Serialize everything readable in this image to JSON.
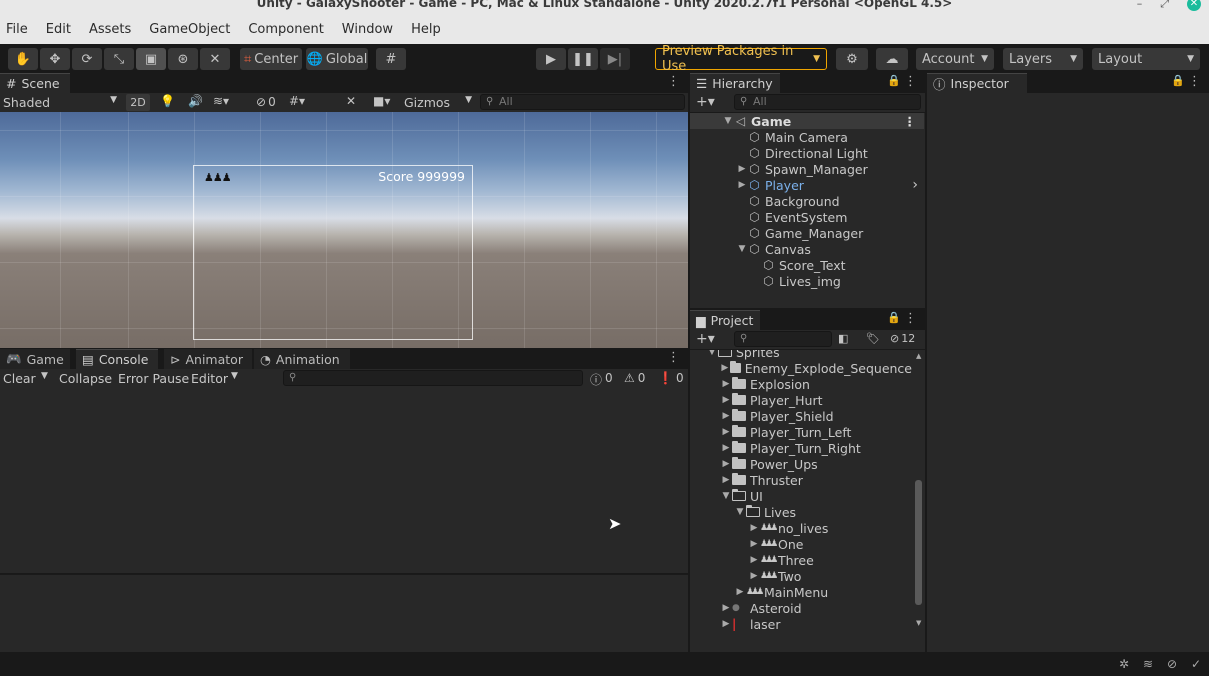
{
  "window": {
    "title": "Unity - GalaxyShooter - Game - PC, Mac & Linux Standalone - Unity 2020.2.7f1 Personal <OpenGL 4.5>",
    "minimize": "–",
    "restore": "⤢",
    "close": "✕"
  },
  "menu": [
    "File",
    "Edit",
    "Assets",
    "GameObject",
    "Component",
    "Window",
    "Help"
  ],
  "toolbar": {
    "center_label": "Center",
    "global_label": "Global",
    "preview_packages": "Preview Packages in Use",
    "account": "Account",
    "layers": "Layers",
    "layout": "Layout",
    "accent_color": "#f0a500"
  },
  "scene": {
    "tab": "Scene",
    "shading": "Shaded",
    "mode_2d": "2D",
    "hidden_count": "0",
    "gizmos": "Gizmos",
    "search_placeholder": "All",
    "score_text": "Score 999999",
    "lives_glyphs": "♟♟♟"
  },
  "bottom_tabs": [
    "Game",
    "Console",
    "Animator",
    "Animation"
  ],
  "console": {
    "clear": "Clear",
    "collapse": "Collapse",
    "error_pause": "Error Pause",
    "editor": "Editor",
    "info_count": "0",
    "warn_count": "0",
    "error_count": "0"
  },
  "hierarchy": {
    "tab": "Hierarchy",
    "search_placeholder": "All",
    "root": "Game",
    "items": [
      {
        "label": "Main Camera",
        "indent": 1,
        "arrow": ""
      },
      {
        "label": "Directional Light",
        "indent": 1,
        "arrow": ""
      },
      {
        "label": "Spawn_Manager",
        "indent": 1,
        "arrow": "▶"
      },
      {
        "label": "Player",
        "indent": 1,
        "arrow": "▶",
        "highlight": true
      },
      {
        "label": "Background",
        "indent": 1,
        "arrow": ""
      },
      {
        "label": "EventSystem",
        "indent": 1,
        "arrow": ""
      },
      {
        "label": "Game_Manager",
        "indent": 1,
        "arrow": ""
      },
      {
        "label": "Canvas",
        "indent": 1,
        "arrow": "▼"
      },
      {
        "label": "Score_Text",
        "indent": 2,
        "arrow": ""
      },
      {
        "label": "Lives_img",
        "indent": 2,
        "arrow": ""
      }
    ],
    "player_color": "#7bb0ea"
  },
  "project": {
    "tab": "Project",
    "hidden_count": "12",
    "items": [
      {
        "label": "Sprites",
        "indent": 0,
        "arrow": "▼",
        "type": "folder-open"
      },
      {
        "label": "Enemy_Explode_Sequence",
        "indent": 1,
        "arrow": "▶",
        "type": "folder"
      },
      {
        "label": "Explosion",
        "indent": 1,
        "arrow": "▶",
        "type": "folder"
      },
      {
        "label": "Player_Hurt",
        "indent": 1,
        "arrow": "▶",
        "type": "folder"
      },
      {
        "label": "Player_Shield",
        "indent": 1,
        "arrow": "▶",
        "type": "folder"
      },
      {
        "label": "Player_Turn_Left",
        "indent": 1,
        "arrow": "▶",
        "type": "folder"
      },
      {
        "label": "Player_Turn_Right",
        "indent": 1,
        "arrow": "▶",
        "type": "folder"
      },
      {
        "label": "Power_Ups",
        "indent": 1,
        "arrow": "▶",
        "type": "folder"
      },
      {
        "label": "Thruster",
        "indent": 1,
        "arrow": "▶",
        "type": "folder"
      },
      {
        "label": "UI",
        "indent": 1,
        "arrow": "▼",
        "type": "folder-open"
      },
      {
        "label": "Lives",
        "indent": 2,
        "arrow": "▼",
        "type": "folder-open"
      },
      {
        "label": "no_lives",
        "indent": 3,
        "arrow": "▶",
        "type": "sprite"
      },
      {
        "label": "One",
        "indent": 3,
        "arrow": "▶",
        "type": "sprite"
      },
      {
        "label": "Three",
        "indent": 3,
        "arrow": "▶",
        "type": "sprite"
      },
      {
        "label": "Two",
        "indent": 3,
        "arrow": "▶",
        "type": "sprite"
      },
      {
        "label": "MainMenu",
        "indent": 2,
        "arrow": "▶",
        "type": "sprite"
      },
      {
        "label": "Asteroid",
        "indent": 1,
        "arrow": "▶",
        "type": "asteroid"
      },
      {
        "label": "laser",
        "indent": 1,
        "arrow": "▶",
        "type": "laser"
      }
    ]
  },
  "inspector": {
    "tab": "Inspector"
  }
}
